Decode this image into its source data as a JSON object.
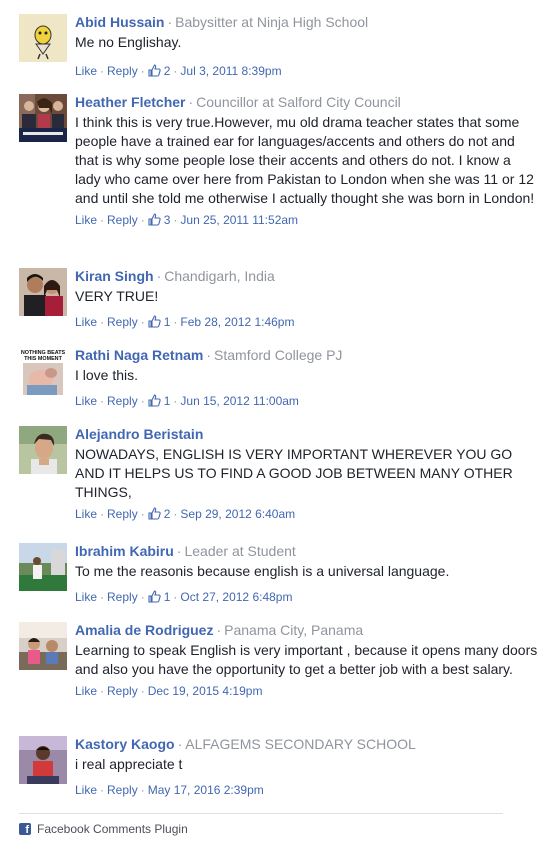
{
  "comments": [
    {
      "name": "Abid Hussain",
      "subtitle": "Babysitter at Ninja High School",
      "text": "Me no Englishay.",
      "like_label": "Like",
      "reply_label": "Reply",
      "likes": "2",
      "date": "Jul 3, 2011 8:39pm"
    },
    {
      "name": "Heather Fletcher",
      "subtitle": "Councillor at Salford City Council",
      "text": "I think this is very true.However, mu old drama teacher states that some people have a trained ear for languages/accents and others do not and that is why some people lose their accents and others do not. I know a lady who came over here from Pakistan to London when she was 11 or 12 and until she told me otherwise I actually thought she was born in London!",
      "like_label": "Like",
      "reply_label": "Reply",
      "likes": "3",
      "date": "Jun 25, 2011 11:52am"
    },
    {
      "name": "Kiran Singh",
      "subtitle": "Chandigarh, India",
      "text": "VERY TRUE!",
      "like_label": "Like",
      "reply_label": "Reply",
      "likes": "1",
      "date": "Feb 28, 2012 1:46pm"
    },
    {
      "name": "Rathi Naga Retnam",
      "subtitle": "Stamford College PJ",
      "text": "I love this.",
      "like_label": "Like",
      "reply_label": "Reply",
      "likes": "1",
      "date": "Jun 15, 2012 11:00am",
      "avatar_text": "NOTHING BEATS THIS MOMENT"
    },
    {
      "name": "Alejandro Beristain",
      "subtitle": "",
      "text": "NOWADAYS, ENGLISH IS VERY IMPORTANT WHEREVER YOU GO AND IT HELPS US TO FIND A GOOD JOB BETWEEN MANY OTHER THINGS,",
      "like_label": "Like",
      "reply_label": "Reply",
      "likes": "2",
      "date": "Sep 29, 2012 6:40am"
    },
    {
      "name": "Ibrahim Kabiru",
      "subtitle": "Leader at Student",
      "text": "To me the reasonis because english is a universal language.",
      "like_label": "Like",
      "reply_label": "Reply",
      "likes": "1",
      "date": "Oct 27, 2012 6:48pm"
    },
    {
      "name": "Amalia de Rodriguez",
      "subtitle": "Panama City, Panama",
      "text": "Learning to speak English is very important , because it opens many doors and also you have the opportunity to get a better job with a best salary.",
      "like_label": "Like",
      "reply_label": "Reply",
      "likes": "",
      "date": "Dec 19, 2015 4:19pm"
    },
    {
      "name": "Kastory Kaogo",
      "subtitle": "ALFAGEMS SECONDARY SCHOOL",
      "text": "i real appreciate t",
      "like_label": "Like",
      "reply_label": "Reply",
      "likes": "",
      "date": "May 17, 2016 2:39pm"
    }
  ],
  "footer": {
    "label": "Facebook Comments Plugin"
  },
  "colors": {
    "link": "#4267b2",
    "meta": "#90949c",
    "text": "#1d2129",
    "facebook": "#3b5998"
  },
  "icons": {
    "like": "thumbs-up-icon",
    "footer": "facebook-icon"
  }
}
